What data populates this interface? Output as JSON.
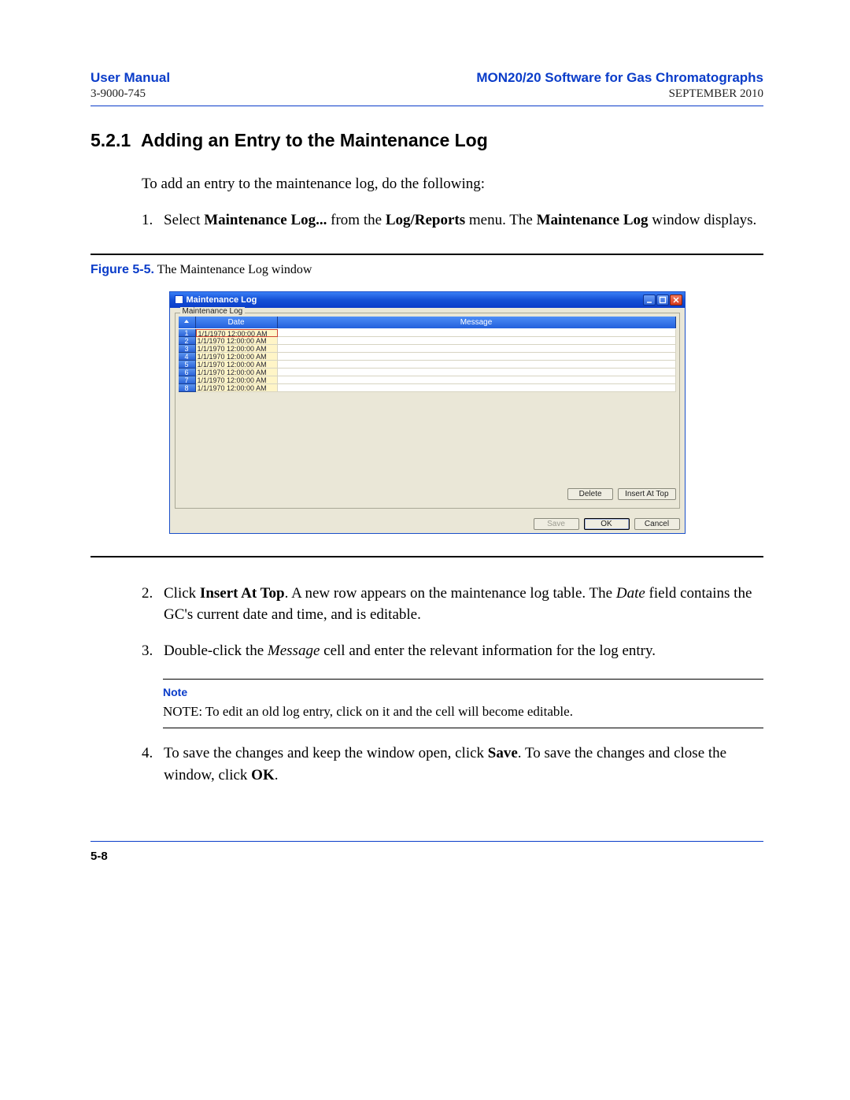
{
  "header": {
    "left_title": "User Manual",
    "left_sub": "3-9000-745",
    "right_title": "MON20/20 Software for Gas Chromatographs",
    "right_sub": "SEPTEMBER 2010"
  },
  "section": {
    "number": "5.2.1",
    "title": "Adding an Entry to the Maintenance Log"
  },
  "intro": "To add an entry to the maintenance log, do the following:",
  "steps": {
    "s1_num": "1.",
    "s1_a": "Select ",
    "s1_b": "Maintenance Log...",
    "s1_c": " from the ",
    "s1_d": "Log/Reports",
    "s1_e": " menu.  The ",
    "s1_f": "Maintenance Log",
    "s1_g": " window displays.",
    "s2_num": "2.",
    "s2_a": "Click ",
    "s2_b": "Insert At Top",
    "s2_c": ".  A new row appears on the maintenance log table.  The ",
    "s2_d": "Date",
    "s2_e": " field contains the GC's current date and time, and is editable.",
    "s3_num": "3.",
    "s3_a": "Double-click the ",
    "s3_b": "Message",
    "s3_c": " cell and enter the relevant information for the log entry.",
    "s4_num": "4.",
    "s4_a": "To save the changes and keep the window open, click ",
    "s4_b": "Save",
    "s4_c": ".  To save the changes and close the window, click ",
    "s4_d": "OK",
    "s4_e": "."
  },
  "figure": {
    "label": "Figure 5-5.",
    "caption": "  The Maintenance Log window"
  },
  "window": {
    "title": "Maintenance Log",
    "group_label": "Maintenance Log",
    "col_date": "Date",
    "col_msg": "Message",
    "rows": [
      {
        "idx": "1",
        "date": "1/1/1970 12:00:00 AM",
        "msg": ""
      },
      {
        "idx": "2",
        "date": "1/1/1970 12:00:00 AM",
        "msg": ""
      },
      {
        "idx": "3",
        "date": "1/1/1970 12:00:00 AM",
        "msg": ""
      },
      {
        "idx": "4",
        "date": "1/1/1970 12:00:00 AM",
        "msg": ""
      },
      {
        "idx": "5",
        "date": "1/1/1970 12:00:00 AM",
        "msg": ""
      },
      {
        "idx": "6",
        "date": "1/1/1970 12:00:00 AM",
        "msg": ""
      },
      {
        "idx": "7",
        "date": "1/1/1970 12:00:00 AM",
        "msg": ""
      },
      {
        "idx": "8",
        "date": "1/1/1970 12:00:00 AM",
        "msg": ""
      }
    ],
    "btn_delete": "Delete",
    "btn_insert": "Insert At Top",
    "btn_save": "Save",
    "btn_ok": "OK",
    "btn_cancel": "Cancel"
  },
  "note": {
    "label": "Note",
    "text": "NOTE: To edit an old log entry, click on it and the cell will become editable."
  },
  "footer": {
    "page": "5-8"
  }
}
